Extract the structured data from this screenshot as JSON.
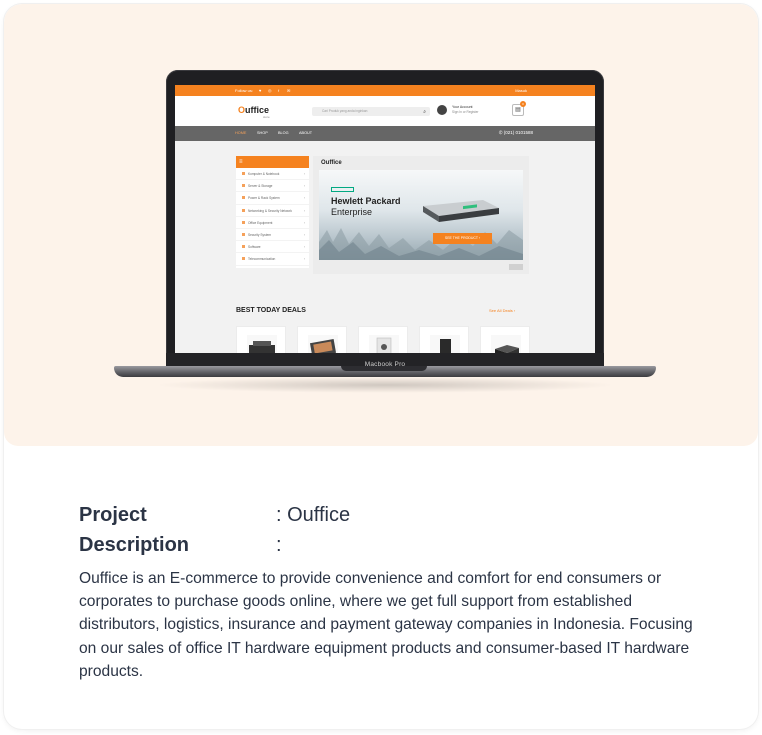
{
  "mockup": {
    "device_label": "Macbook Pro",
    "site": {
      "topbar": {
        "follow": "Follow us:",
        "social": [
          "♥",
          "◎",
          "f",
          "✉"
        ],
        "lang": "Masuk"
      },
      "logo": {
        "name_o": "O",
        "name_rest": "uffice",
        "sub": "store"
      },
      "search": {
        "placeholder": "Cari Produk yang anda inginkan"
      },
      "account": {
        "title": "Your Account",
        "sub": "Sign In or Register"
      },
      "cart_count": "0",
      "nav": [
        "HOME",
        "SHOP",
        "BLOG",
        "ABOUT"
      ],
      "phone": "(021) 0101588",
      "categories": [
        "Komputer & Notebook",
        "Server & Storage",
        "Power & Rack System",
        "Networking & Security Network",
        "Office Equipment",
        "Security System",
        "Software",
        "Telecommunication"
      ],
      "banner": {
        "logo": "Ouffice",
        "brand_line1": "Hewlett Packard",
        "brand_line2": "Enterprise",
        "cta": "SEE THE PRODUCT  ›"
      },
      "deals": {
        "title": "BEST TODAY DEALS",
        "see_all": "See All Deals  ›"
      }
    }
  },
  "project": {
    "project_label": "Project",
    "project_value": ": Ouffice",
    "description_label": "Description",
    "description_colon": ":",
    "description": "Ouffice is an E-commerce to provide convenience and comfort for end consumers or corporates to purchase goods online, where we get full support from established distributors, logistics, insurance and payment gateway companies in Indonesia. Focusing on our sales of office IT hardware equipment products and consumer-based IT hardware products."
  },
  "colors": {
    "accent": "#f5821f",
    "hero_bg": "#fdf3ea",
    "text": "#2b3445",
    "hpe_green": "#01a982"
  }
}
